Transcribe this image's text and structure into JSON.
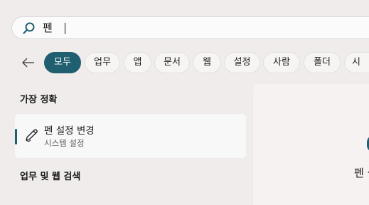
{
  "search": {
    "query": "펜"
  },
  "filters": [
    {
      "label": "모두",
      "active": true
    },
    {
      "label": "업무",
      "active": false
    },
    {
      "label": "앱",
      "active": false
    },
    {
      "label": "문서",
      "active": false
    },
    {
      "label": "웹",
      "active": false
    },
    {
      "label": "설정",
      "active": false
    },
    {
      "label": "사람",
      "active": false
    },
    {
      "label": "폴더",
      "active": false
    },
    {
      "label": "시",
      "active": false
    }
  ],
  "best_match": {
    "heading": "가장 정확",
    "result": {
      "title": "펜 설정 변경",
      "subtitle": "시스템 설정",
      "icon": "pen-icon"
    }
  },
  "work_web_heading": "업무 및 웹 검색",
  "preview": {
    "title": "펜 설정"
  },
  "colors": {
    "accent": "#1f5f6f",
    "background": "#f0eceb"
  }
}
